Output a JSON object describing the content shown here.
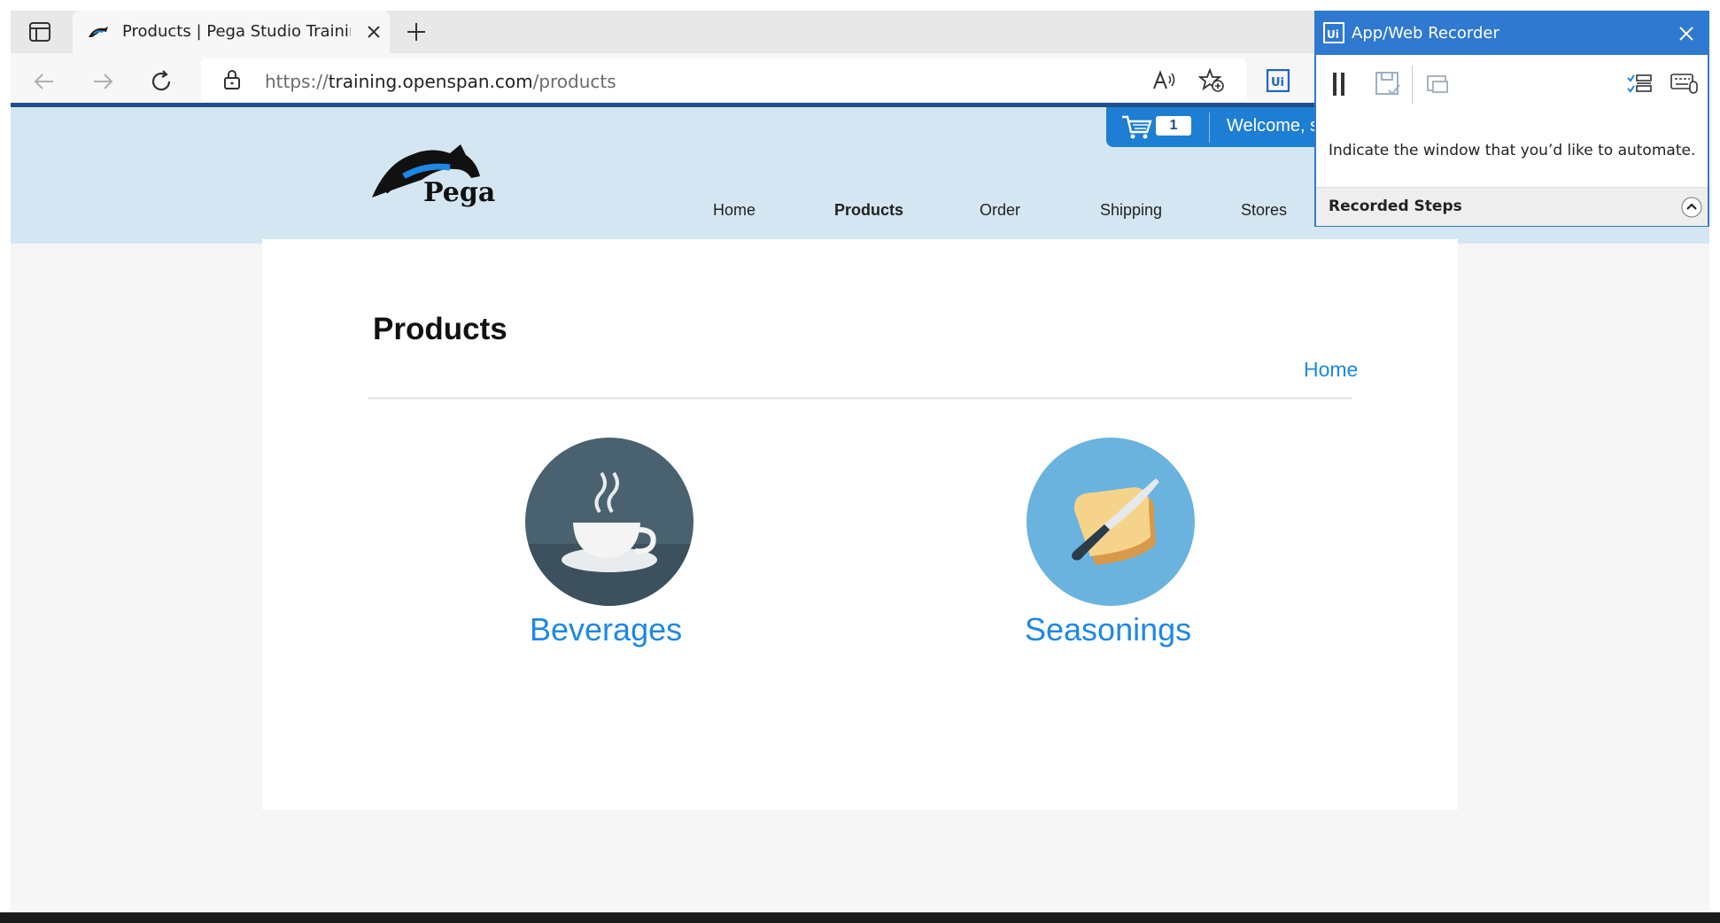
{
  "browser": {
    "tab_title": "Products | Pega Studio Training V",
    "url_prefix": "https://",
    "url_host": "training.openspan.com",
    "url_path": "/products"
  },
  "site": {
    "cart_count": "1",
    "welcome": "Welcome, s",
    "logo_text": "Pega",
    "nav": [
      "Home",
      "Products",
      "Order",
      "Shipping",
      "Stores"
    ],
    "active_nav": "Products",
    "page_title": "Products",
    "breadcrumb_home": "Home",
    "products": [
      {
        "label": "Beverages",
        "icon": "coffee-cup-icon"
      },
      {
        "label": "Seasonings",
        "icon": "bread-knife-icon"
      }
    ]
  },
  "recorder": {
    "title": "App/Web Recorder",
    "badge": "Ui",
    "message": "Indicate the window that you’d like to automate.",
    "steps_label": "Recorded Steps"
  },
  "colors": {
    "header_bg": "#d4e6f1",
    "accent_blue": "#1e88e5",
    "cart_blue": "#1e7ed4",
    "recorder_blue": "#2f79d0",
    "beverages_circle": "#4a6270",
    "seasonings_circle": "#6ab3de"
  }
}
